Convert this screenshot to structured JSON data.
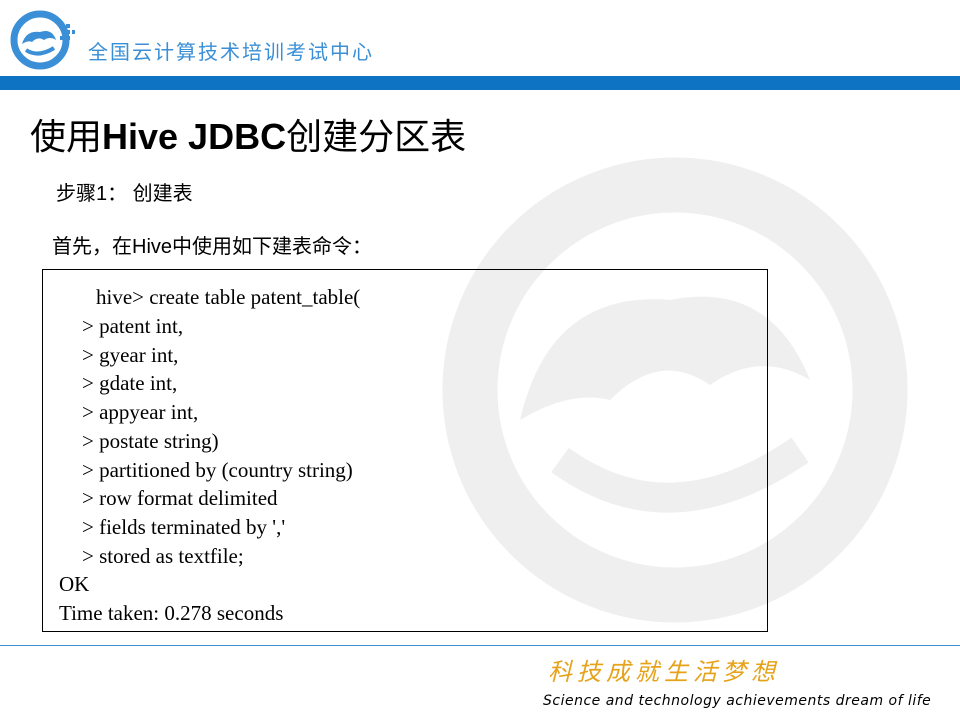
{
  "header": {
    "org_name": "全国云计算技术培训考试中心",
    "bar_color": "#0f73c4",
    "logo_icon": "cloud-swirl-logo-icon"
  },
  "slide": {
    "title_cn_before": "使用",
    "title_latin": "Hive JDBC",
    "title_cn_after": "创建分区表",
    "step_label": "步骤1：  创建表",
    "intro": "首先，在Hive中使用如下建表命令："
  },
  "code": {
    "lines": [
      "hive> create table patent_table(",
      "> patent int,",
      "> gyear int,",
      "> gdate int,",
      "> appyear int,",
      "> postate string)",
      "> partitioned by (country string)",
      "> row format delimited",
      "> fields terminated by ','",
      "> stored as textfile;",
      "OK",
      "Time taken: 0.278 seconds"
    ]
  },
  "footer": {
    "slogan": "科技成就生活梦想",
    "tagline": "Science and technology achievements dream of life",
    "slogan_color": "#e6a21a"
  }
}
